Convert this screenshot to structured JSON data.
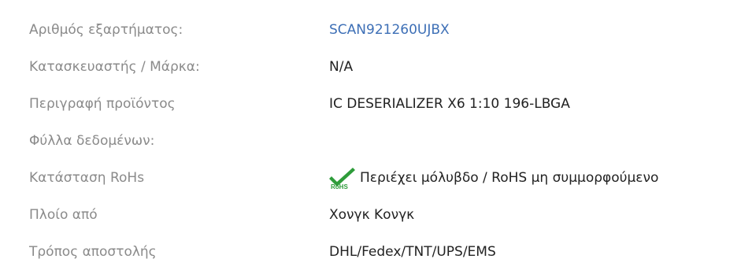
{
  "specs": [
    {
      "label": "Αριθμός εξαρτήματος:",
      "value": "SCAN921260UJBX",
      "link": true
    },
    {
      "label": "Κατασκευαστής / Μάρκα:",
      "value": "N/A"
    },
    {
      "label": "Περιγραφή προϊόντος",
      "value": "IC DESERIALIZER X6 1:10 196-LBGA"
    },
    {
      "label": "Φύλλα δεδομένων:",
      "value": ""
    },
    {
      "label": "Κατάσταση RoHs",
      "value": "Περιέχει μόλυβδο / RoHS μη συμμορφούμενο",
      "icon": "rohs-check-icon",
      "icon_text": "RoHS"
    },
    {
      "label": "Πλοίο από",
      "value": "Χονγκ Κονγκ"
    },
    {
      "label": "Τρόπος αποστολής",
      "value": "DHL/Fedex/TNT/UPS/EMS"
    }
  ],
  "colors": {
    "label": "#8a8a8a",
    "value": "#222222",
    "link": "#3d6fb6",
    "check": "#2e9c3a"
  }
}
